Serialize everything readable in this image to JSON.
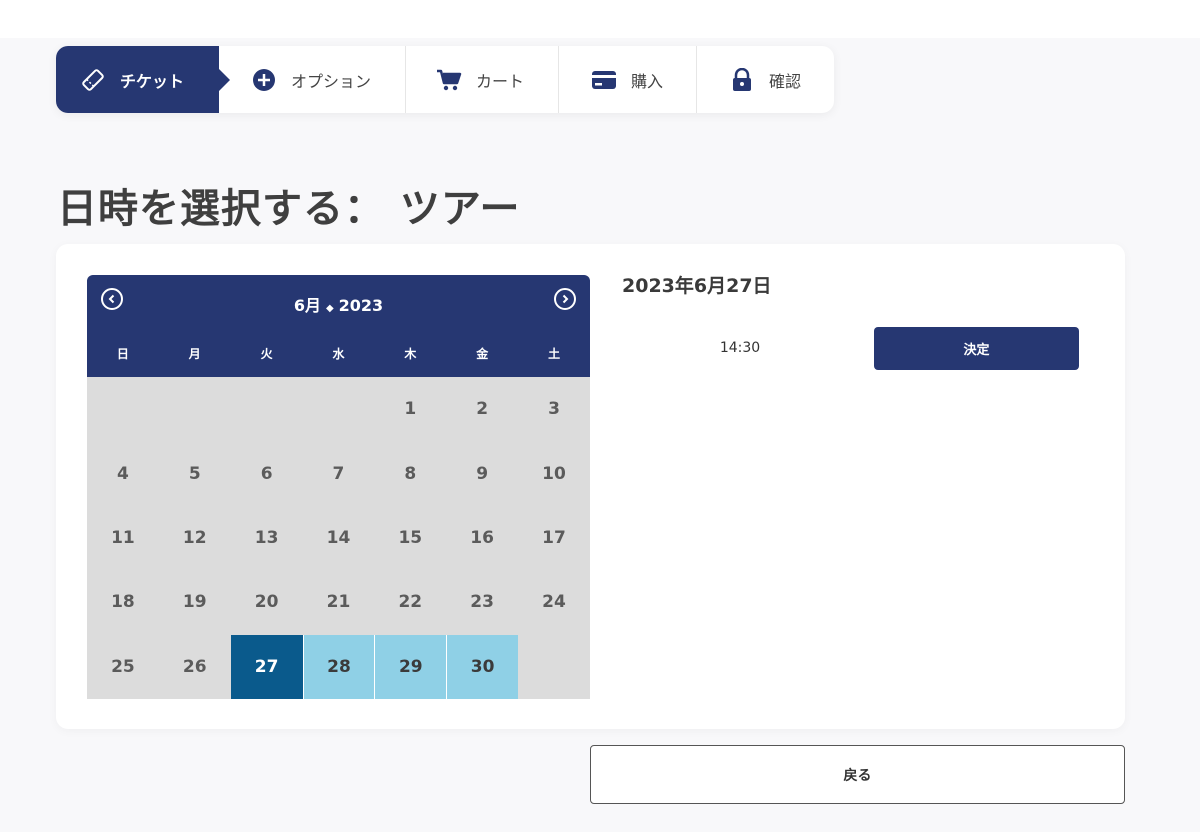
{
  "steps": [
    {
      "label": "チケット",
      "icon": "ticket-icon"
    },
    {
      "label": "オプション",
      "icon": "plus-circle-icon"
    },
    {
      "label": "カート",
      "icon": "cart-icon"
    },
    {
      "label": "購入",
      "icon": "credit-card-icon"
    },
    {
      "label": "確認",
      "icon": "lock-icon"
    }
  ],
  "page_title": "日時を選択する： ツアー",
  "calendar": {
    "month": "6月",
    "year": "2023",
    "weekdays": [
      "日",
      "月",
      "火",
      "水",
      "木",
      "金",
      "土"
    ],
    "leading_blanks": 4,
    "days_in_month": 30,
    "selected_day": 27,
    "available_days": [
      28,
      29,
      30
    ]
  },
  "selection": {
    "date": "2023年6月27日",
    "time": "14:30",
    "decide_label": "決定"
  },
  "back_label": "戻る",
  "colors": {
    "primary": "#263772",
    "selected_day": "#0a5a8c",
    "available_day": "#8fd0e6",
    "disabled_day": "#dcdcdc"
  }
}
